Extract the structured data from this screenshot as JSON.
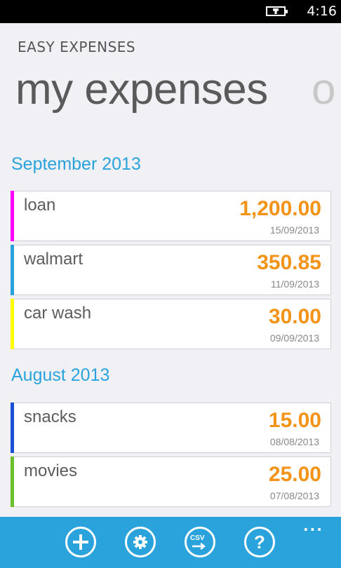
{
  "status": {
    "time": "4:16",
    "battery_icon": "battery-charging-icon"
  },
  "app": {
    "title": "EASY EXPENSES"
  },
  "pivot": {
    "current": "my expenses",
    "next_peek": "o"
  },
  "groups": [
    {
      "title": "September 2013",
      "items": [
        {
          "name": "loan",
          "amount": "1,200.00",
          "date": "15/09/2013",
          "color": "#ff00ff"
        },
        {
          "name": "walmart",
          "amount": "350.85",
          "date": "11/09/2013",
          "color": "#2aa3dc"
        },
        {
          "name": "car wash",
          "amount": "30.00",
          "date": "09/09/2013",
          "color": "#ffff00"
        }
      ]
    },
    {
      "title": "August 2013",
      "items": [
        {
          "name": "snacks",
          "amount": "15.00",
          "date": "08/08/2013",
          "color": "#1a4fd6"
        },
        {
          "name": "movies",
          "amount": "25.00",
          "date": "07/08/2013",
          "color": "#6abf2a"
        }
      ]
    }
  ],
  "appbar": {
    "buttons": [
      {
        "icon": "add-icon"
      },
      {
        "icon": "settings-icon"
      },
      {
        "icon": "csv-export-icon",
        "label": "CSV"
      },
      {
        "icon": "help-icon",
        "label": "?"
      }
    ],
    "more": "..."
  },
  "colors": {
    "accent": "#2aa3dc",
    "amount": "#f39318"
  }
}
